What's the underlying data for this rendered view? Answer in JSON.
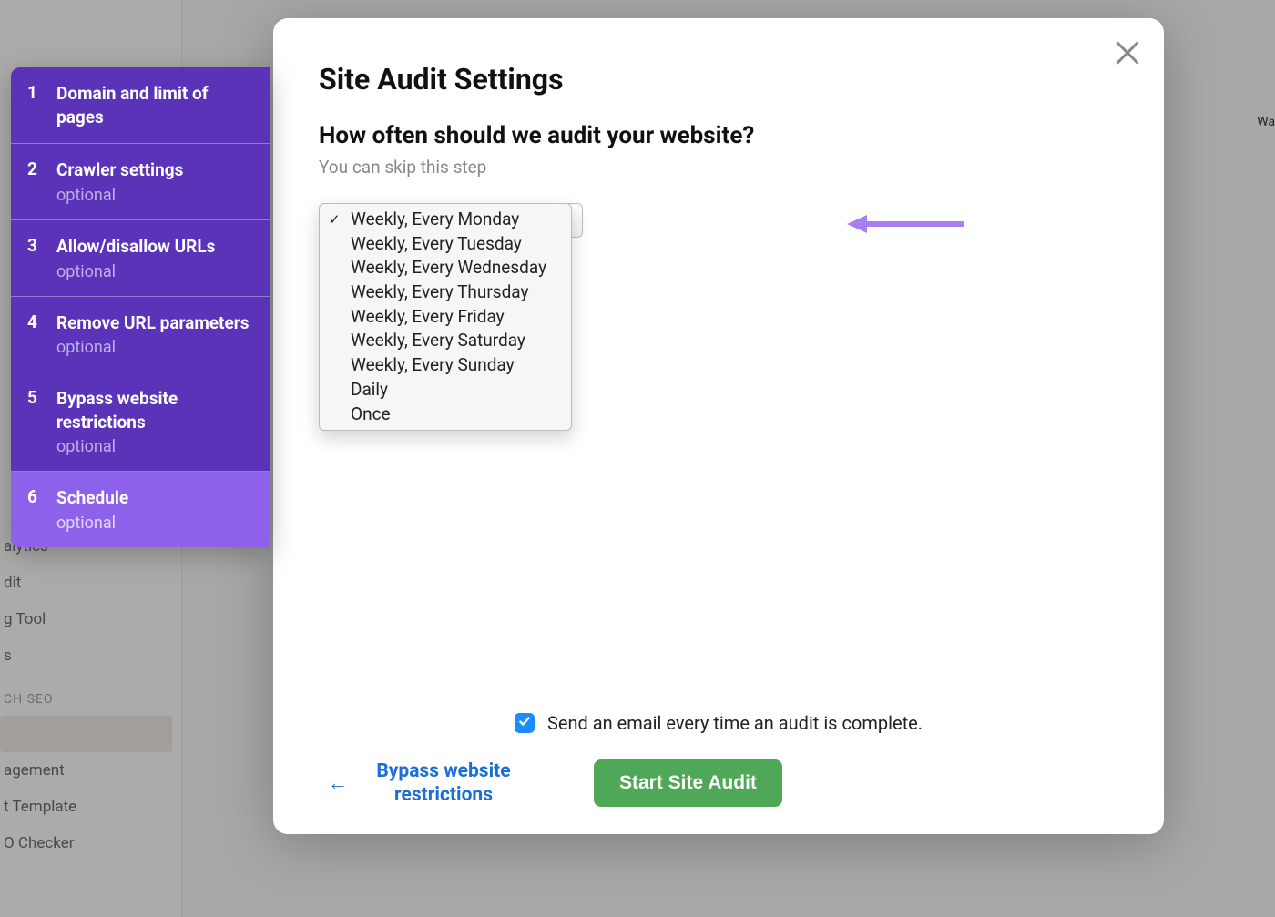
{
  "modal": {
    "title": "Site Audit Settings",
    "question": "How often should we audit your website?",
    "subtext": "You can skip this step",
    "schedule_options": [
      {
        "label": "Weekly, Every Monday",
        "selected": true
      },
      {
        "label": "Weekly, Every Tuesday",
        "selected": false
      },
      {
        "label": "Weekly, Every Wednesday",
        "selected": false
      },
      {
        "label": "Weekly, Every Thursday",
        "selected": false
      },
      {
        "label": "Weekly, Every Friday",
        "selected": false
      },
      {
        "label": "Weekly, Every Saturday",
        "selected": false
      },
      {
        "label": "Weekly, Every Sunday",
        "selected": false
      },
      {
        "label": "Daily",
        "selected": false
      },
      {
        "label": "Once",
        "selected": false
      }
    ],
    "email_checkbox": {
      "checked": true,
      "label": "Send an email every time an audit is complete."
    },
    "back_link": "Bypass website restrictions",
    "start_button": "Start Site Audit"
  },
  "stepper": {
    "optional_label": "optional",
    "steps": [
      {
        "num": "1",
        "label": "Domain and limit of pages",
        "optional": false
      },
      {
        "num": "2",
        "label": "Crawler settings",
        "optional": true
      },
      {
        "num": "3",
        "label": "Allow/disallow URLs",
        "optional": true
      },
      {
        "num": "4",
        "label": "Remove URL parameters",
        "optional": true
      },
      {
        "num": "5",
        "label": "Bypass website restrictions",
        "optional": true
      },
      {
        "num": "6",
        "label": "Schedule",
        "optional": true
      }
    ],
    "active_index": 5
  },
  "background_sidebar": {
    "items": [
      "alytics",
      "dit",
      "g Tool",
      "s"
    ],
    "section_label": "CH SEO",
    "items2": [
      "agement",
      "t Template",
      "O Checker"
    ]
  },
  "background_label_right": "Wa",
  "colors": {
    "stepper_bg": "#5a33b8",
    "stepper_active": "#8d61e9",
    "primary_button": "#4fa858",
    "link_blue": "#1a6fd6",
    "checkbox_blue": "#1a8cff",
    "annotation_purple": "#a87ff0"
  }
}
